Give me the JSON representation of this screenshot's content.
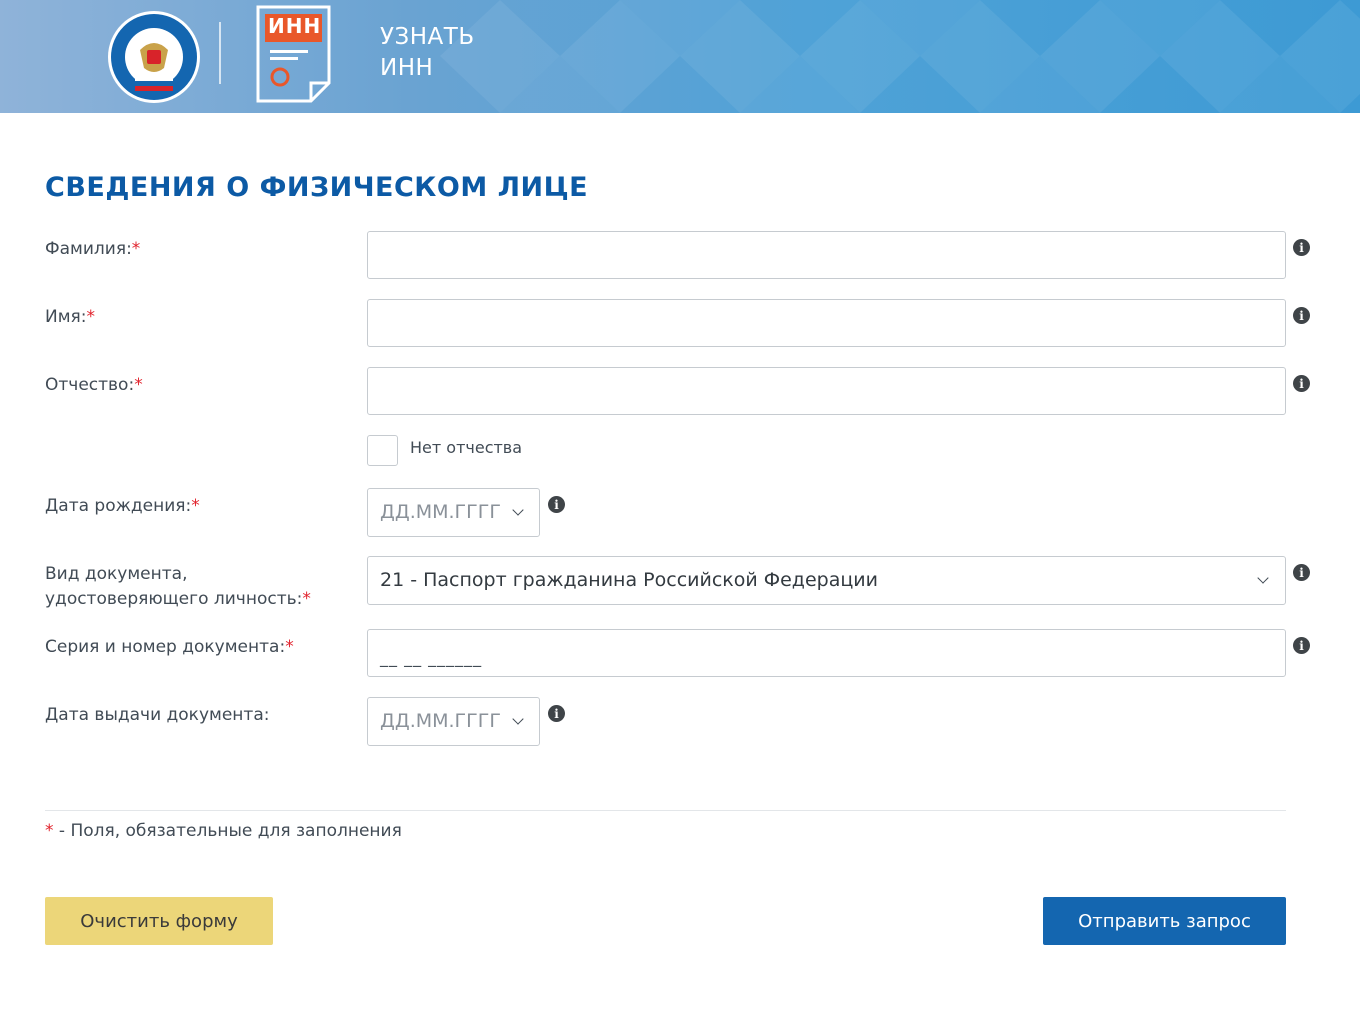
{
  "header": {
    "title_line1": "УЗНАТЬ",
    "title_line2": "ИНН",
    "fns_logo_icon": "fns-emblem-icon",
    "inn_logo_text": "ИНН",
    "inn_logo_icon": "inn-document-icon"
  },
  "section": {
    "title": "СВЕДЕНИЯ О ФИЗИЧЕСКОМ ЛИЦЕ"
  },
  "fields": {
    "surname_label": "Фамилия:",
    "name_label": "Имя:",
    "patronymic_label": "Отчество:",
    "no_patronymic_label": "Нет отчества",
    "birth_date_label": "Дата рождения:",
    "birth_date_placeholder": "ДД.ММ.ГГГГ",
    "doc_type_label_line1": "Вид документа,",
    "doc_type_label_line2": "удостоверяющего личность:",
    "doc_type_value": "21 - Паспорт гражданина Российской Федерации",
    "doc_number_label": "Серия и номер документа:",
    "doc_number_mask": "__ __ ______",
    "issue_date_label": "Дата выдачи документа:",
    "issue_date_placeholder": "ДД.ММ.ГГГГ",
    "required_mark": "*",
    "info_glyph": "i"
  },
  "footer": {
    "required_note_mark": "*",
    "required_note": " - Поля, обязательные для заполнения",
    "clear_button": "Очистить форму",
    "send_button": "Отправить запрос"
  },
  "colors": {
    "accent_blue": "#0c5aa5",
    "send_button": "#1466b0",
    "clear_button": "#ecd679",
    "required": "#e1232d",
    "inn_orange": "#e9572a"
  }
}
